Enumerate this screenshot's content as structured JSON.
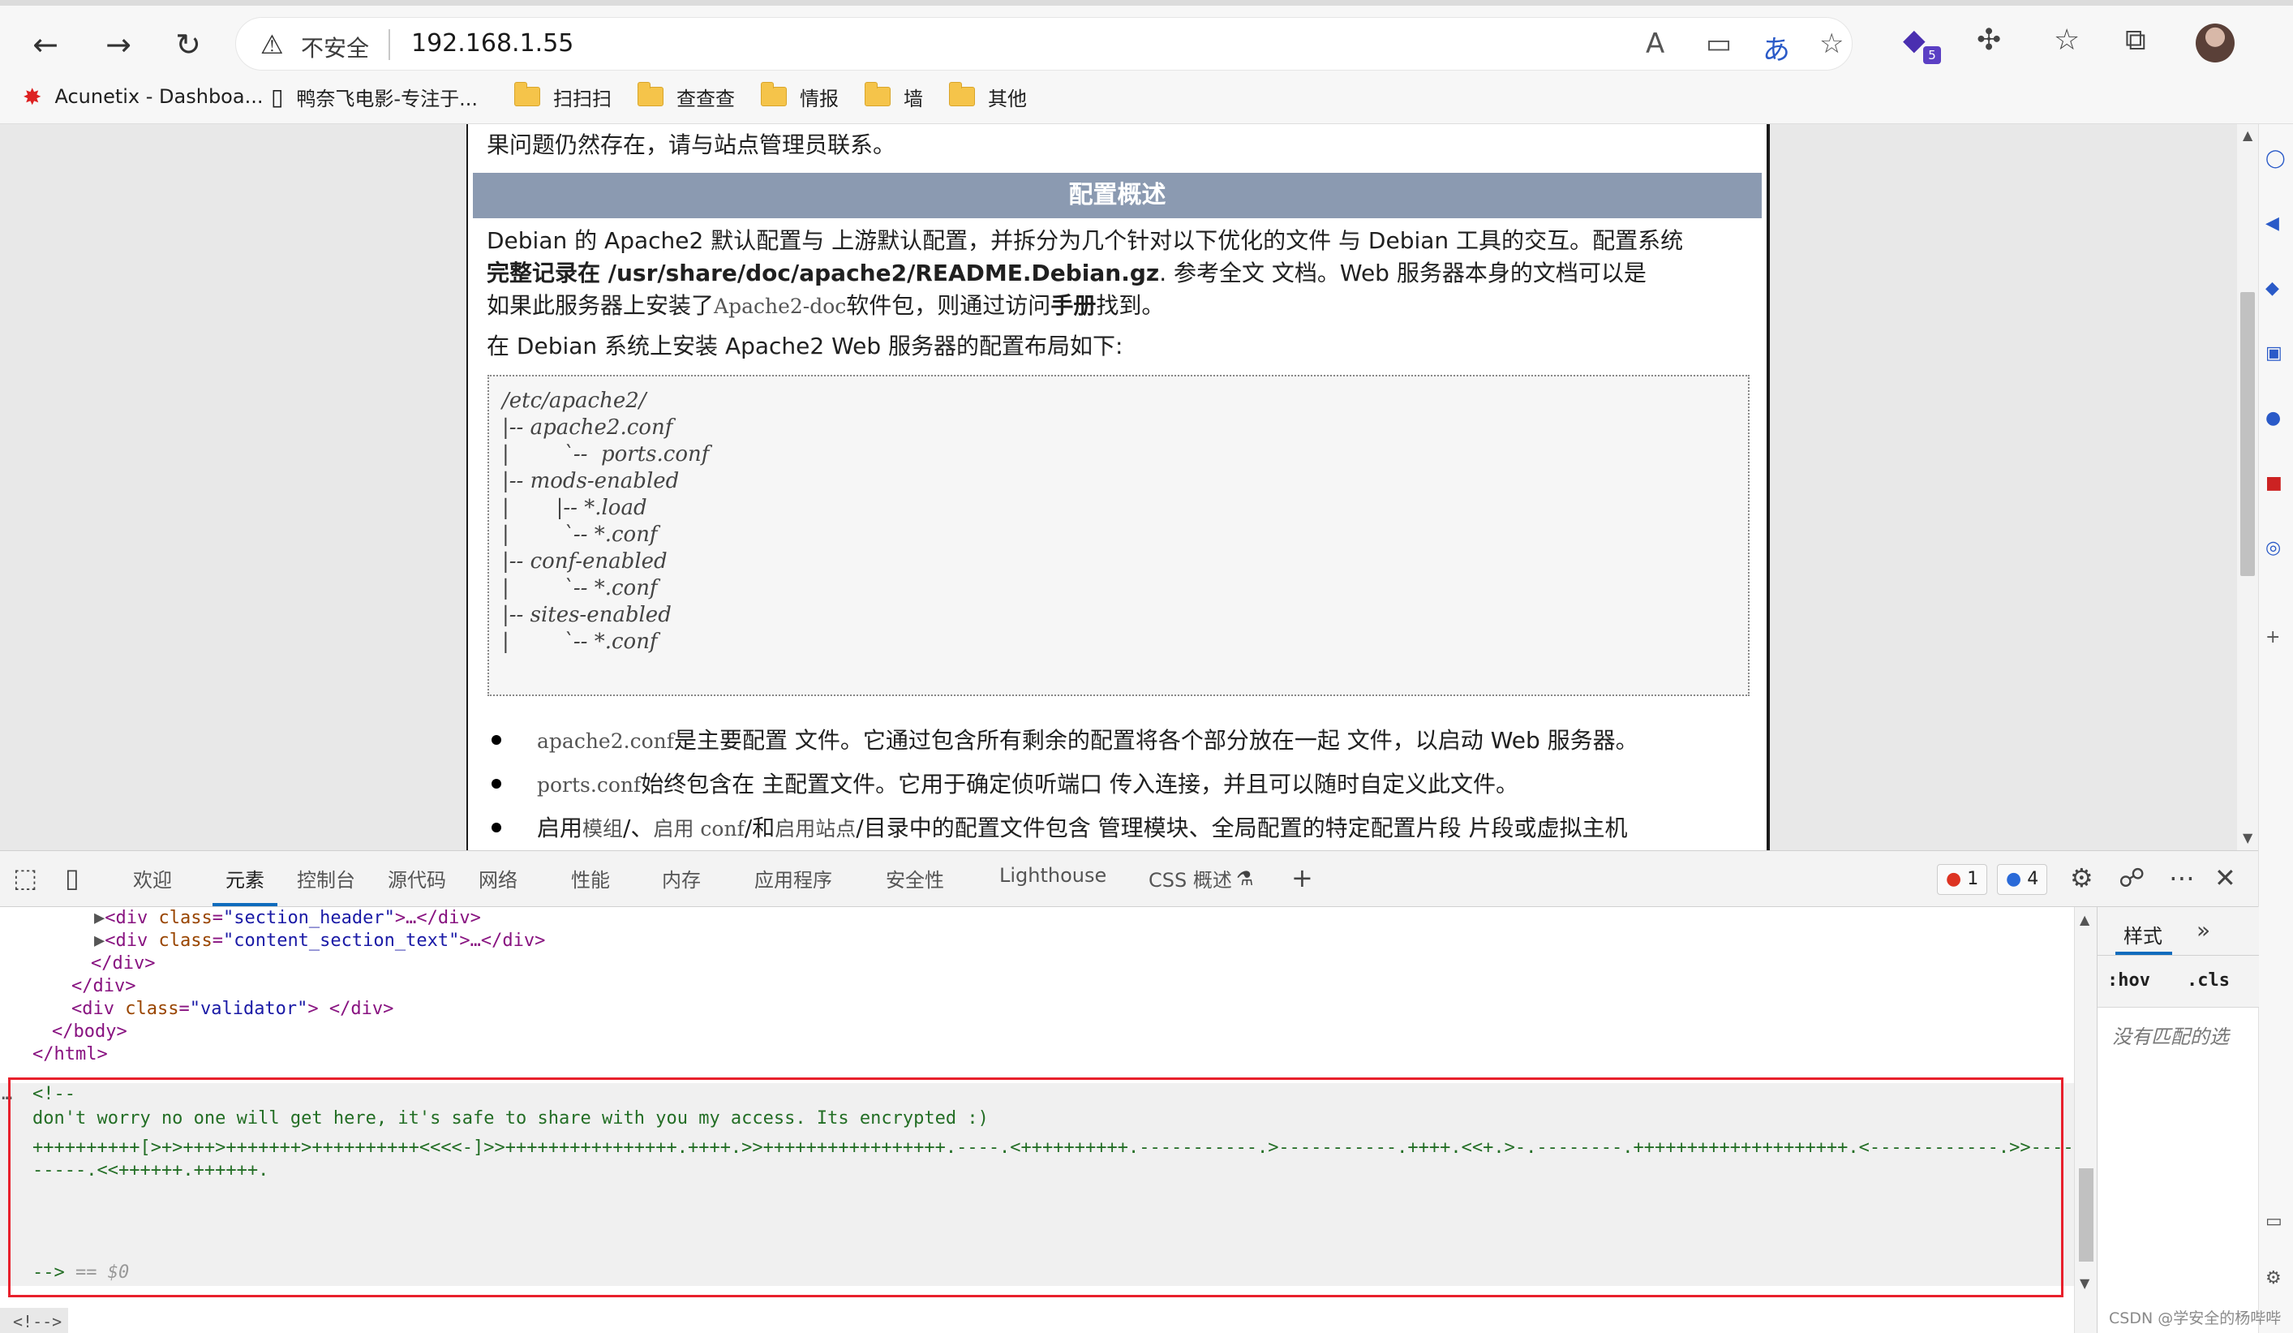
{
  "browser": {
    "security_label": "不安全",
    "url": "192.168.1.55",
    "extension_badge": "5",
    "bookmarks": [
      {
        "label": "Acunetix - Dashboa...",
        "type": "site"
      },
      {
        "label": "鸭奈飞电影-专注于...",
        "type": "page"
      },
      {
        "label": "扫扫扫",
        "type": "folder"
      },
      {
        "label": "查查查",
        "type": "folder"
      },
      {
        "label": "情报",
        "type": "folder"
      },
      {
        "label": "墙",
        "type": "folder"
      },
      {
        "label": "其他",
        "type": "folder"
      }
    ]
  },
  "page": {
    "top_line": "果问题仍然存在，请与站点管理员联系。",
    "section_title": "配置概述",
    "para1_l1": "Debian 的 Apache2 默认配置与 上游默认配置，并拆分为几个针对以下优化的文件 与 Debian 工具的交互。配置系统",
    "para1_l2_bold": "完整记录在 /usr/share/doc/apache2/README.Debian.gz",
    "para1_l2_rest": ". 参考全文 文档。Web 服务器本身的文档可以是",
    "para1_l3_a": "如果此服务器上安装了",
    "para1_l3_code": "Apache2-doc",
    "para1_l3_b": "软件包，则通过访问",
    "para1_l3_bold": "手册",
    "para1_l3_c": "找到。",
    "para2": "在 Debian 系统上安装 Apache2 Web 服务器的配置布局如下:",
    "tree": "/etc/apache2/\n|-- apache2.conf\n|        `--  ports.conf\n|-- mods-enabled\n|       |-- *.load\n|        `-- *.conf\n|-- conf-enabled\n|        `-- *.conf\n|-- sites-enabled\n|        `-- *.conf",
    "bullets": [
      {
        "code": "apache2.conf",
        "text": "是主要配置 文件。它通过包含所有剩余的配置将各个部分放在一起 文件，以启动 Web 服务器。"
      },
      {
        "code": "ports.conf",
        "text": "始终包含在 主配置文件。它用于确定侦听端口 传入连接，并且可以随时自定义此文件。"
      },
      {
        "pre": "启用",
        "code1": "模组",
        "mid": "/、",
        "code2": "启用 conf",
        "mid2": "/和",
        "code3": "启用站点",
        "text": "/目录中的配置文件包含 管理模块、全局配置的特定配置片段 片段或虚拟主机"
      }
    ]
  },
  "devtools": {
    "tabs": [
      "欢迎",
      "元素",
      "控制台",
      "源代码",
      "网络",
      "性能",
      "内存",
      "应用程序",
      "安全性",
      "Lighthouse",
      "CSS 概述"
    ],
    "active_tab": "元素",
    "errors": "1",
    "messages": "4",
    "dom_lines": [
      {
        "indent": 0,
        "tag_open": "<div",
        "attr": "class",
        "val": "\"section_header\"",
        "tail": ">…</div>"
      },
      {
        "indent": 0,
        "tag_open": "<div",
        "attr": "class",
        "val": "\"content_section_text\"",
        "tail": ">…</div>"
      },
      {
        "close": "</div>"
      },
      {
        "close": "</div>"
      },
      {
        "tag_open": "<div",
        "attr": "class",
        "val": "\"validator\"",
        "tail": "> </div>"
      },
      {
        "close": "</body>"
      },
      {
        "close": "</html>"
      }
    ],
    "comment_open": "<!--",
    "comment_text": "don't worry no one will get here, it's safe to share with you my access. Its encrypted :)",
    "comment_code_l1": "++++++++++[>+>+++>+++++++>++++++++++<<<<-]>>++++++++++++++++.++++.>>+++++++++++++++++.----.<++++++++++.-----------.>-----------.++++.<<+.>-.--------.++++++++++++++++++++.<------------.>>----",
    "comment_code_l2": "-----.<<++++++.++++++.",
    "comment_close": "-->",
    "selected_marker": "== $0",
    "ellipsis": "…",
    "bottom_breadcrumb": "<!-->",
    "styles_tab": "样式",
    "hov": ":hov",
    "cls": ".cls",
    "no_match": "没有匹配的选"
  },
  "watermark": "CSDN @学安全的杨哔哔"
}
